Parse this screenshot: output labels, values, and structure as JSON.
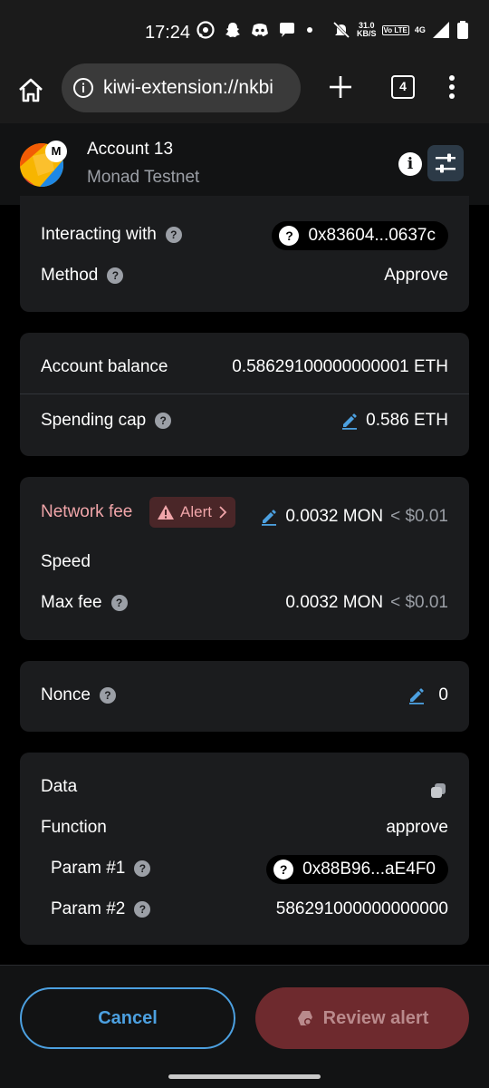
{
  "status_bar": {
    "time": "17:24",
    "net_speed_value": "31.0",
    "net_speed_unit": "KB/S",
    "volte": "Vo LTE",
    "network_type": "4G",
    "icons": [
      "whatsapp-icon",
      "snapchat-icon",
      "discord-icon",
      "chat-icon",
      "dot-icon",
      "bell-muted-icon",
      "signal-icon",
      "battery-icon"
    ]
  },
  "browser": {
    "url": "kiwi-extension://nkbi",
    "tab_count": "4"
  },
  "account": {
    "name": "Account 13",
    "network": "Monad Testnet",
    "badge": "M"
  },
  "details": {
    "interacting_label": "Interacting with",
    "interacting_address": "0x83604...0637c",
    "method_label": "Method",
    "method_value": "Approve"
  },
  "balance": {
    "account_balance_label": "Account balance",
    "account_balance_value": "0.58629100000000001 ETH",
    "spending_cap_label": "Spending cap",
    "spending_cap_value": "0.586 ETH"
  },
  "fees": {
    "network_fee_label": "Network fee",
    "alert_label": "Alert",
    "network_fee_value": "0.0032 MON",
    "network_fee_fiat": "< $0.01",
    "speed_label": "Speed",
    "max_fee_label": "Max fee",
    "max_fee_value": "0.0032 MON",
    "max_fee_fiat": "< $0.01"
  },
  "nonce": {
    "label": "Nonce",
    "value": "0"
  },
  "data": {
    "label": "Data",
    "function_label": "Function",
    "function_value": "approve",
    "param1_label": "Param #1",
    "param1_value": "0x88B96...aE4F0",
    "param2_label": "Param #2",
    "param2_value": "586291000000000000"
  },
  "actions": {
    "cancel_label": "Cancel",
    "review_label": "Review alert"
  },
  "colors": {
    "accent_blue": "#4ca0e0",
    "alert_red": "#f0a5a9",
    "danger_button": "#6e2a2e"
  }
}
